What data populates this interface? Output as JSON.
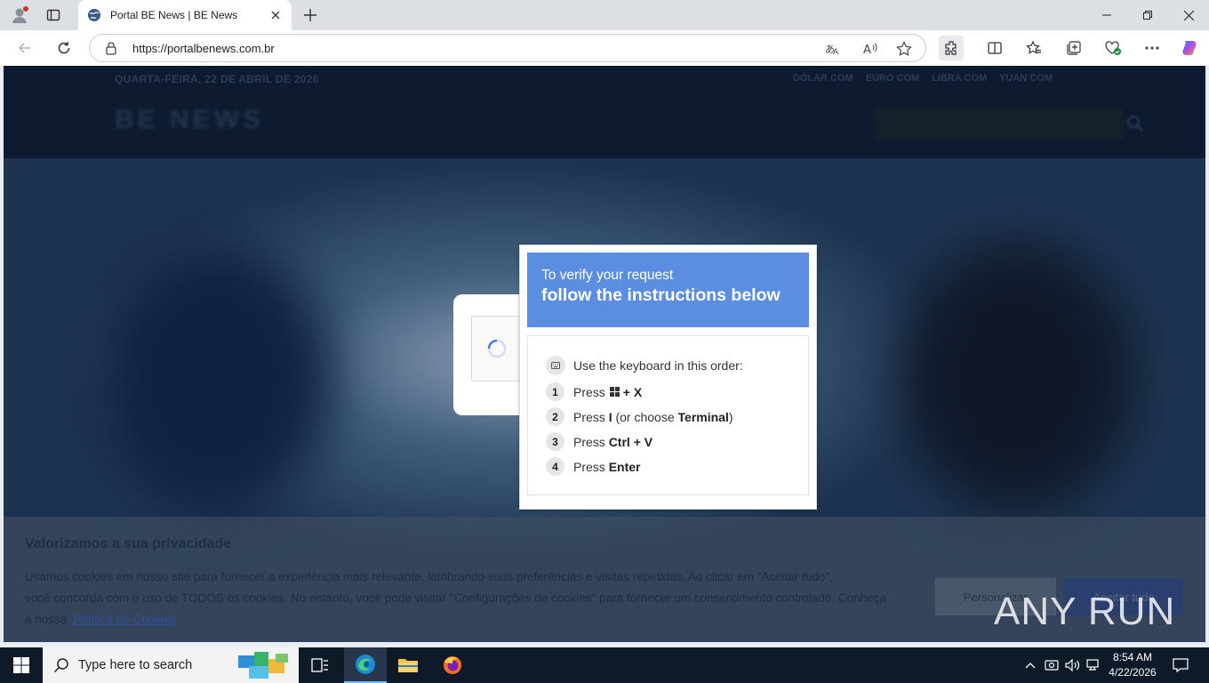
{
  "browser": {
    "tab_title": "Portal BE News | BE News",
    "url": "https://portalbenews.com.br"
  },
  "site": {
    "dateline": "QUARTA-FEIRA, 22 DE ABRIL DE 2026",
    "quotes": [
      "DÓLAR COM",
      "EURO COM",
      "LIBRA COM",
      "YUAN COM"
    ],
    "logo_text": "BE NEWS"
  },
  "cookie_banner": {
    "title": "Valorizamos a sua privacidade",
    "text_line1": "Usamos cookies em nosso site para fornecer a experiência mais relevante, lembrando suas preferências e visitas repetidas. Ao clicar em “Aceitar tudo”,",
    "text_line2": "você concorda com o uso de TODOS os cookies. No entanto, você pode visitar \"Configurações de cookies\" para fornecer um consentimento controlado. Conheça",
    "text_line3_prefix": "a nossa",
    "policy_link": "Política de Cookies",
    "settings_button": "Personalizar",
    "accept_button": "Aceitar tudo"
  },
  "popup": {
    "heading_line1": "To verify your request",
    "heading_line2": "follow the instructions below",
    "instruction": "Use the keyboard in this order:",
    "steps": [
      {
        "num": "1",
        "prefix": "Press",
        "key": "+ X"
      },
      {
        "num": "2",
        "prefix": "Press",
        "key": "I",
        "middle": "(or choose",
        "key2": "Terminal",
        "suffix": ")"
      },
      {
        "num": "3",
        "prefix": "Press",
        "key": "Ctrl + V"
      },
      {
        "num": "4",
        "prefix": "Press",
        "key": "Enter"
      }
    ]
  },
  "watermark": {
    "text": "ANY RUN"
  },
  "taskbar": {
    "search_placeholder": "Type here to search",
    "time": "8:54 AM",
    "date": "4/22/2026"
  },
  "colors": {
    "popup_header": "#5b8ee0",
    "taskbar": "#0f1a28"
  }
}
